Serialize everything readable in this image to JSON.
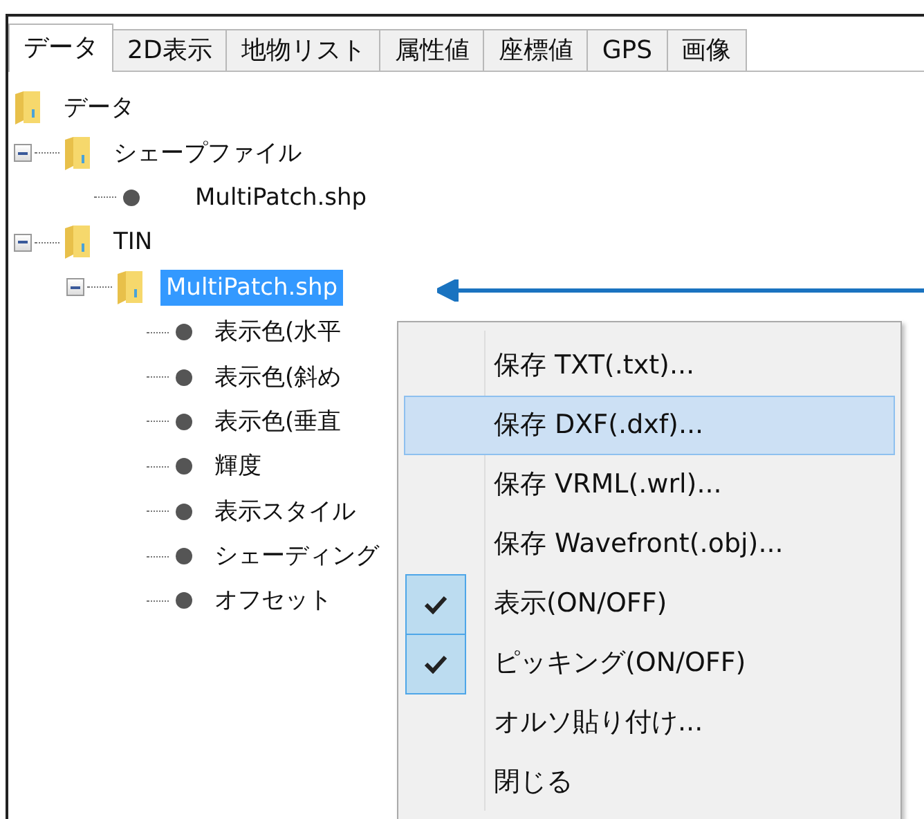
{
  "tabs": [
    {
      "label": "データ",
      "selected": true
    },
    {
      "label": "2D表示",
      "selected": false
    },
    {
      "label": "地物リスト",
      "selected": false
    },
    {
      "label": "属性値",
      "selected": false
    },
    {
      "label": "座標値",
      "selected": false
    },
    {
      "label": "GPS",
      "selected": false
    },
    {
      "label": "画像",
      "selected": false
    }
  ],
  "tree": [
    {
      "label": "データ",
      "kind": "folder",
      "selected": false,
      "children": [
        {
          "label": "シェープファイル",
          "kind": "folder",
          "expanded": true,
          "selected": false,
          "children": [
            {
              "label": "MultiPatch.shp",
              "kind": "leaf",
              "selected": false
            }
          ]
        },
        {
          "label": "TIN",
          "kind": "folder",
          "expanded": true,
          "selected": false,
          "children": [
            {
              "label": "MultiPatch.shp",
              "kind": "folder",
              "expanded": true,
              "selected": true,
              "children": [
                {
                  "label": "表示色(水平",
                  "kind": "leaf",
                  "selected": false
                },
                {
                  "label": "表示色(斜め",
                  "kind": "leaf",
                  "selected": false
                },
                {
                  "label": "表示色(垂直",
                  "kind": "leaf",
                  "selected": false
                },
                {
                  "label": "輝度",
                  "kind": "leaf",
                  "selected": false
                },
                {
                  "label": "表示スタイル",
                  "kind": "leaf",
                  "selected": false
                },
                {
                  "label": "シェーディング",
                  "kind": "leaf",
                  "selected": false
                },
                {
                  "label": "オフセット",
                  "kind": "leaf",
                  "selected": false
                }
              ]
            }
          ]
        }
      ]
    }
  ],
  "context_menu": [
    {
      "label": "保存 TXT(.txt)...",
      "checked": false,
      "selected": false
    },
    {
      "label": "保存 DXF(.dxf)...",
      "checked": false,
      "selected": true
    },
    {
      "label": "保存 VRML(.wrl)...",
      "checked": false,
      "selected": false
    },
    {
      "label": "保存 Wavefront(.obj)...",
      "checked": false,
      "selected": false
    },
    {
      "label": "表示(ON/OFF)",
      "checked": true,
      "selected": false
    },
    {
      "label": "ピッキング(ON/OFF)",
      "checked": true,
      "selected": false
    },
    {
      "label": "オルソ貼り付け...",
      "checked": false,
      "selected": false
    },
    {
      "label": "閉じる",
      "checked": false,
      "selected": false
    }
  ]
}
